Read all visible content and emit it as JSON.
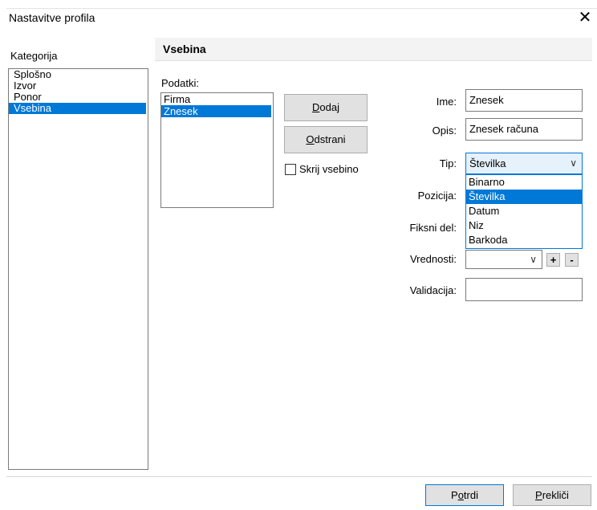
{
  "window": {
    "title": "Nastavitve profila",
    "close_glyph": "✕"
  },
  "sidebar": {
    "label": "Kategorija",
    "items": [
      {
        "label": "Splošno",
        "selected": false
      },
      {
        "label": "Izvor",
        "selected": false
      },
      {
        "label": "Ponor",
        "selected": false
      },
      {
        "label": "Vsebina",
        "selected": true
      }
    ]
  },
  "content": {
    "header": "Vsebina",
    "data_label": "Podatki:",
    "data_items": [
      {
        "label": "Firma",
        "selected": false
      },
      {
        "label": "Znesek",
        "selected": true
      }
    ],
    "add_button": {
      "before": "",
      "mnemonic": "D",
      "after": "odaj"
    },
    "remove_button": {
      "before": "",
      "mnemonic": "O",
      "after": "dstrani"
    },
    "hide_checkbox": {
      "label": "Skrij vsebino",
      "checked": false
    }
  },
  "properties": {
    "ime_label": "Ime:",
    "ime_value": "Znesek",
    "opis_label": "Opis:",
    "opis_value": "Znesek računa",
    "tip_label": "Tip:",
    "tip_value": "Številka",
    "tip_options": [
      "Binarno",
      "Številka",
      "Datum",
      "Niz",
      "Barkoda"
    ],
    "tip_selected_index": 1,
    "pozicija_label": "Pozicija:",
    "fiksni_label": "Fiksni del:",
    "vrednosti_label": "Vrednosti:",
    "vrednosti_value": "",
    "plus_label": "+",
    "minus_label": "-",
    "validacija_label": "Validacija:",
    "validacija_value": ""
  },
  "footer": {
    "ok_button": {
      "before": "P",
      "mnemonic": "o",
      "after": "trdi"
    },
    "cancel_button": {
      "before": "",
      "mnemonic": "P",
      "after": "rekliči"
    }
  },
  "colors": {
    "accent": "#0078d7",
    "selection_text": "#ffffff",
    "button_bg": "#e1e1e1"
  }
}
